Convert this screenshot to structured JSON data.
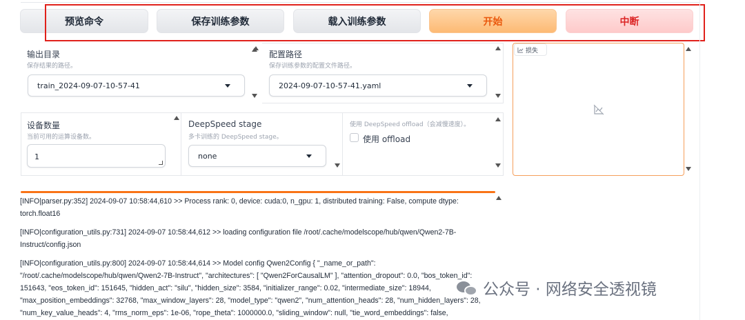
{
  "buttons": {
    "preview": "预览命令",
    "save": "保存训练参数",
    "load": "载入训练参数",
    "start": "开始",
    "abort": "中断"
  },
  "output_dir": {
    "label": "输出目录",
    "hint": "保存结果的路径。",
    "value": "train_2024-09-07-10-57-41"
  },
  "config_path": {
    "label": "配置路径",
    "hint": "保存训练参数的配置文件路径。",
    "value": "2024-09-07-10-57-41.yaml"
  },
  "device_count": {
    "label": "设备数量",
    "hint": "当前可用的运算设备数。",
    "value": "1"
  },
  "deepspeed": {
    "label": "DeepSpeed stage",
    "hint": "多卡训练的 DeepSpeed stage。",
    "value": "none"
  },
  "offload": {
    "hint": "使用 DeepSpeed offload（会减慢速度）。",
    "checkbox_label": "使用 offload"
  },
  "loss_plot": {
    "tag": "损失"
  },
  "log": {
    "lines": [
      "[INFO|parser.py:352] 2024-09-07 10:58:44,610 >> Process rank: 0, device: cuda:0, n_gpu: 1, distributed training: False, compute dtype: torch.float16",
      "[INFO|configuration_utils.py:731] 2024-09-07 10:58:44,612 >> loading configuration file /root/.cache/modelscope/hub/qwen/Qwen2-7B-Instruct/config.json",
      "[INFO|configuration_utils.py:800] 2024-09-07 10:58:44,614 >> Model config Qwen2Config { \"_name_or_path\": \"/root/.cache/modelscope/hub/qwen/Qwen2-7B-Instruct\", \"architectures\": [ \"Qwen2ForCausalLM\" ], \"attention_dropout\": 0.0, \"bos_token_id\": 151643, \"eos_token_id\": 151645, \"hidden_act\": \"silu\", \"hidden_size\": 3584, \"initializer_range\": 0.02, \"intermediate_size\": 18944, \"max_position_embeddings\": 32768, \"max_window_layers\": 28, \"model_type\": \"qwen2\", \"num_attention_heads\": 28, \"num_hidden_layers\": 28, \"num_key_value_heads\": 4, \"rms_norm_eps\": 1e-06, \"rope_theta\": 1000000.0, \"sliding_window\": null, \"tie_word_embeddings\": false,"
    ]
  },
  "watermark": {
    "text": "公众号 · 网络安全透视镜"
  },
  "colors": {
    "start_text": "#ea580c",
    "abort_text": "#dc2626",
    "highlight": "#e0201a",
    "log_bar": "#f97316"
  }
}
